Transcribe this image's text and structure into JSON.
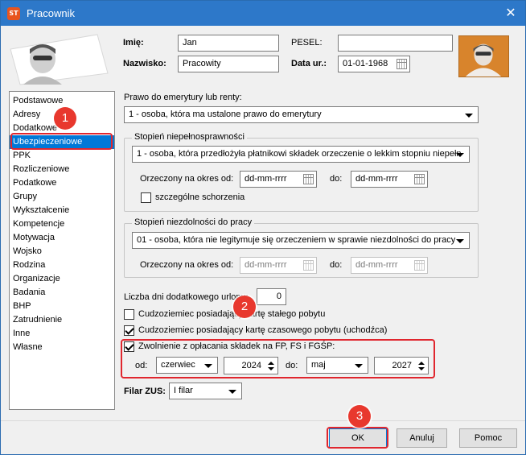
{
  "window": {
    "title": "Pracownik",
    "app_icon_text": "ST"
  },
  "personal": {
    "first_name_label": "Imię:",
    "first_name_value": "Jan",
    "last_name_label": "Nazwisko:",
    "last_name_value": "Pracowity",
    "pesel_label": "PESEL:",
    "pesel_value": "",
    "birthdate_label": "Data ur.:",
    "birthdate_value": "01-01-1968"
  },
  "sidebar": {
    "items": [
      {
        "label": "Podstawowe"
      },
      {
        "label": "Adresy"
      },
      {
        "label": "Dodatkowe"
      },
      {
        "label": "Ubezpieczeniowe",
        "selected": true
      },
      {
        "label": "PPK"
      },
      {
        "label": "Rozliczeniowe"
      },
      {
        "label": "Podatkowe"
      },
      {
        "label": "Grupy"
      },
      {
        "label": "Wykształcenie"
      },
      {
        "label": "Kompetencje"
      },
      {
        "label": "Motywacja"
      },
      {
        "label": "Wojsko"
      },
      {
        "label": "Rodzina"
      },
      {
        "label": "Organizacje"
      },
      {
        "label": "Badania"
      },
      {
        "label": "BHP"
      },
      {
        "label": "Zatrudnienie"
      },
      {
        "label": "Inne"
      },
      {
        "label": "Własne"
      }
    ]
  },
  "pension": {
    "label": "Prawo do emerytury lub renty:",
    "value": "1 - osoba, która ma ustalone prawo do emerytury"
  },
  "disability": {
    "legend": "Stopień niepełnosprawności",
    "value": "1 - osoba, która przedłożyła płatnikowi składek orzeczenie o lekkim stopniu niepełn",
    "period_label": "Orzeczony na okres od:",
    "from_placeholder": "dd-mm-rrrr",
    "to_label": "do:",
    "to_placeholder": "dd-mm-rrrr",
    "special_label": "szczególne schorzenia",
    "special_checked": false
  },
  "incapacity": {
    "legend": "Stopień niezdolności do pracy",
    "value": "01 - osoba, która nie legitymuje się orzeczeniem w sprawie niezdolności do pracy",
    "period_label": "Orzeczony na okres od:",
    "from_placeholder": "dd-mm-rrrr",
    "to_label": "do:",
    "to_placeholder": "dd-mm-rrrr"
  },
  "extra_leave": {
    "label": "Liczba dni dodatkowego urlopu:",
    "value": "0"
  },
  "foreigner_permanent": {
    "label": "Cudzoziemiec posiadający kartę stałego pobytu",
    "checked": false
  },
  "foreigner_temporary": {
    "label": "Cudzoziemiec posiadający kartę czasowego pobytu (uchodźca)",
    "checked": true
  },
  "exemption": {
    "label": "Zwolnienie z opłacania składek na FP, FS i FGŚP:",
    "checked": true,
    "from_label": "od:",
    "from_month": "czerwiec",
    "from_year": "2024",
    "to_label": "do:",
    "to_month": "maj",
    "to_year": "2027"
  },
  "zus": {
    "label": "Filar ZUS:",
    "value": "I filar"
  },
  "buttons": {
    "ok": "OK",
    "cancel": "Anuluj",
    "help": "Pomoc"
  },
  "annotations": {
    "step1": "1",
    "step2": "2",
    "step3": "3",
    "highlight_color": "#e0262e"
  }
}
